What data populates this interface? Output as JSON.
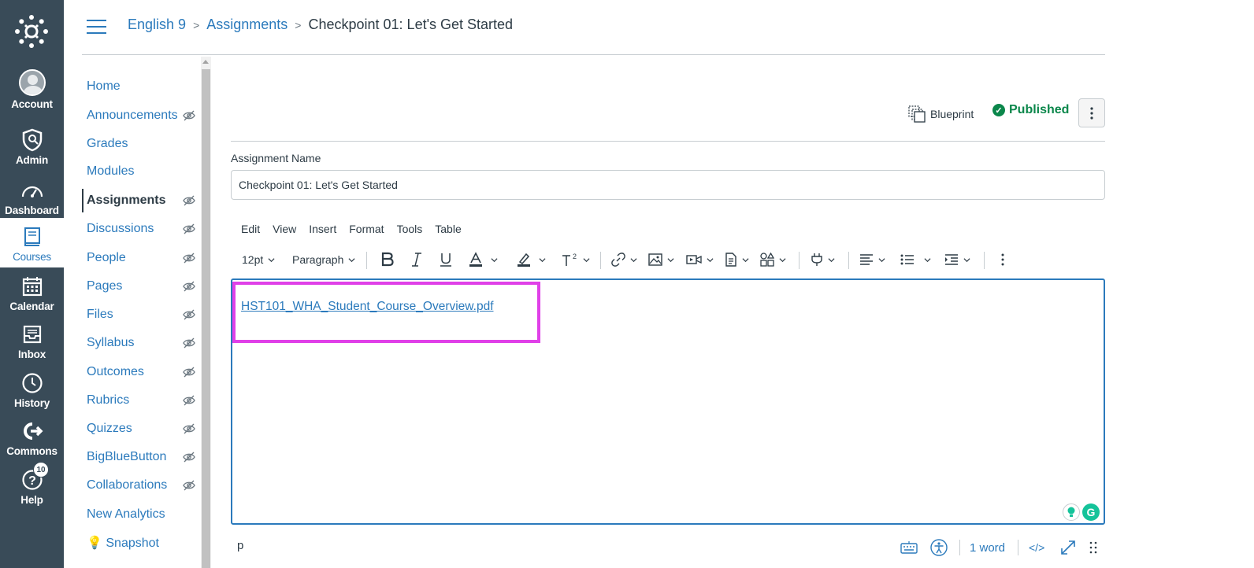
{
  "global_nav": {
    "items": [
      {
        "label": "Account",
        "icon": "avatar-icon"
      },
      {
        "label": "Admin",
        "icon": "shield-icon"
      },
      {
        "label": "Dashboard",
        "icon": "dashboard-icon"
      },
      {
        "label": "Courses",
        "icon": "book-icon"
      },
      {
        "label": "Calendar",
        "icon": "calendar-icon"
      },
      {
        "label": "Inbox",
        "icon": "inbox-icon"
      },
      {
        "label": "History",
        "icon": "clock-icon"
      },
      {
        "label": "Commons",
        "icon": "commons-icon"
      },
      {
        "label": "Help",
        "icon": "help-icon"
      }
    ],
    "help_badge": "10",
    "active_item": "Courses"
  },
  "breadcrumb": {
    "course": "English 9",
    "section": "Assignments",
    "current": "Checkpoint 01: Let's Get Started"
  },
  "course_nav": {
    "items": [
      {
        "label": "Home",
        "hidden": false
      },
      {
        "label": "Announcements",
        "hidden": true
      },
      {
        "label": "Grades",
        "hidden": false
      },
      {
        "label": "Modules",
        "hidden": false
      },
      {
        "label": "Assignments",
        "hidden": true
      },
      {
        "label": "Discussions",
        "hidden": true
      },
      {
        "label": "People",
        "hidden": true
      },
      {
        "label": "Pages",
        "hidden": true
      },
      {
        "label": "Files",
        "hidden": true
      },
      {
        "label": "Syllabus",
        "hidden": true
      },
      {
        "label": "Outcomes",
        "hidden": true
      },
      {
        "label": "Rubrics",
        "hidden": true
      },
      {
        "label": "Quizzes",
        "hidden": true
      },
      {
        "label": "BigBlueButton",
        "hidden": true
      },
      {
        "label": "Collaborations",
        "hidden": true
      },
      {
        "label": "New Analytics",
        "hidden": false
      },
      {
        "label": "💡 Snapshot",
        "hidden": false
      }
    ],
    "active_item": "Assignments"
  },
  "actions": {
    "blueprint_label": "Blueprint",
    "published_label": "Published"
  },
  "form": {
    "name_label": "Assignment Name",
    "name_value": "Checkpoint 01: Let's Get Started"
  },
  "editor": {
    "menubar": [
      "Edit",
      "View",
      "Insert",
      "Format",
      "Tools",
      "Table"
    ],
    "font_size": "12pt",
    "block_format": "Paragraph",
    "content_link": "HST101_WHA_Student_Course_Overview.pdf",
    "status_path": "p",
    "word_count": "1 word",
    "html_toggle": "</>"
  },
  "colors": {
    "nav_bg": "#394b58",
    "link": "#2b7abc",
    "published": "#0b874b",
    "highlight": "#e040e8"
  }
}
